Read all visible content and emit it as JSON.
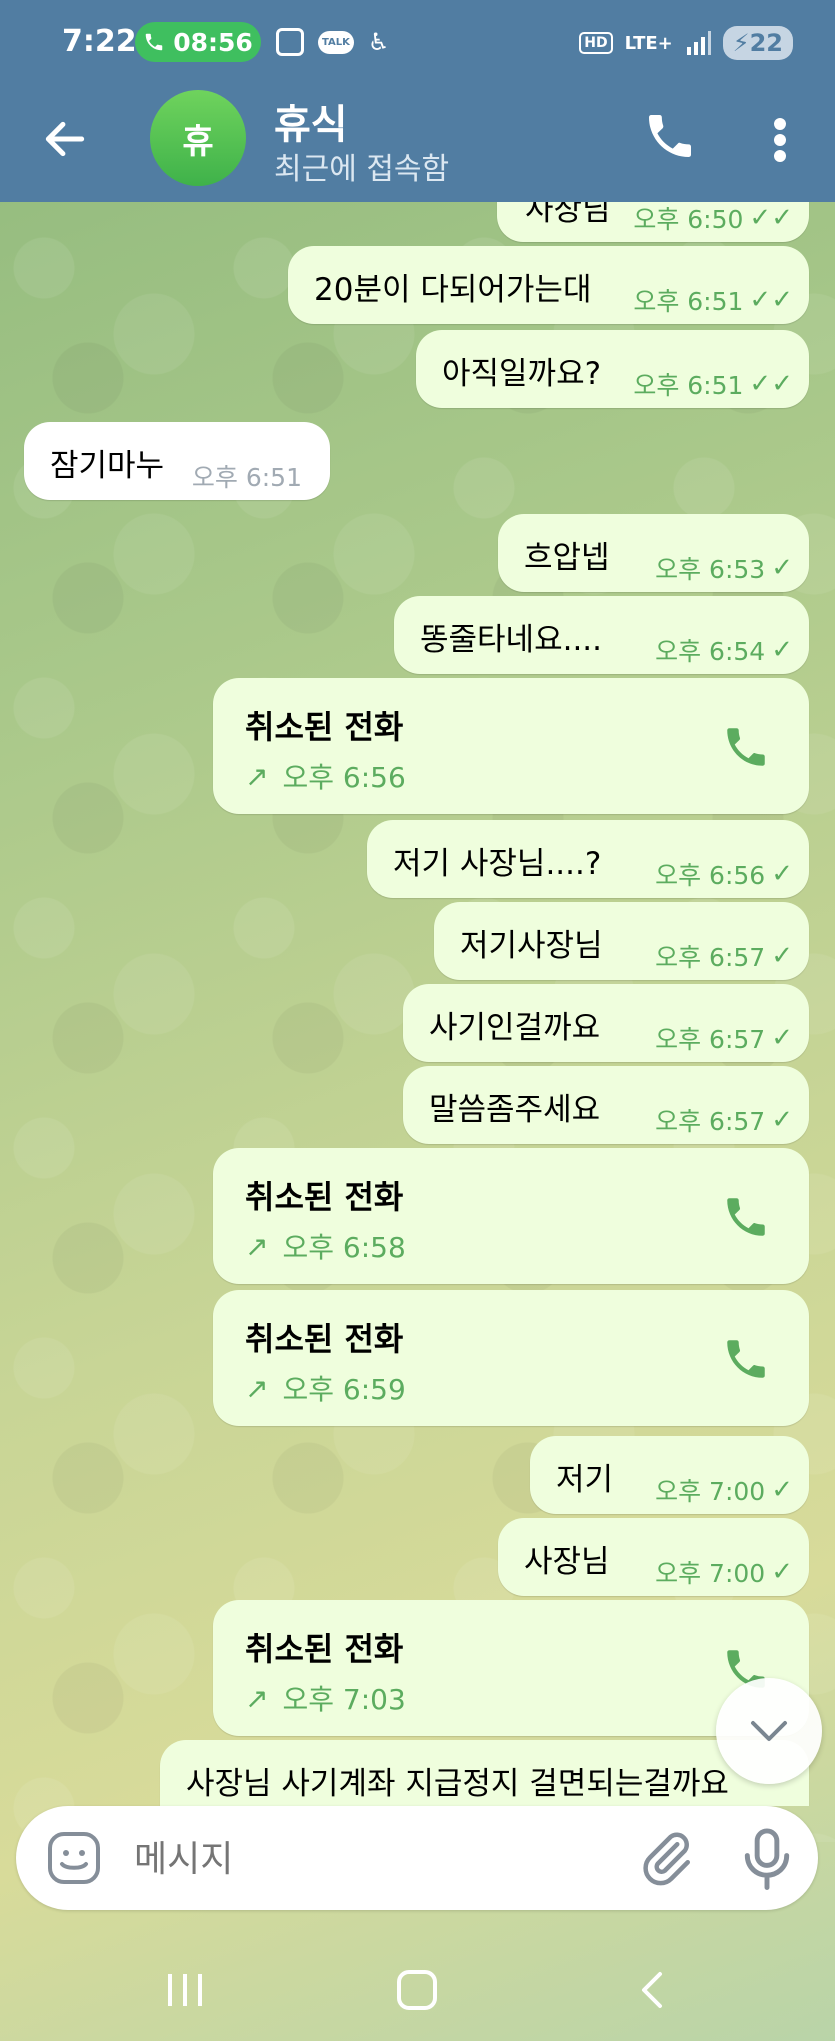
{
  "status_bar": {
    "time": "7:22",
    "call_time": "08:56",
    "talk_label": "TALK",
    "hd": "HD",
    "network": "LTE+",
    "battery": "22"
  },
  "header": {
    "avatar_letter": "휴",
    "contact_name": "휴식",
    "contact_status": "최근에 접속함"
  },
  "messages": [
    {
      "text": "사장님",
      "time": "오후 6:50"
    },
    {
      "text": "20분이 다되어가는대",
      "time": "오후 6:51"
    },
    {
      "text": "아직일까요?",
      "time": "오후 6:51"
    },
    {
      "text": "잠기마누",
      "time": "오후 6:51"
    },
    {
      "text": "흐압넵",
      "time": "오후 6:53"
    },
    {
      "text": "똥줄타네요....",
      "time": "오후 6:54"
    },
    {
      "text": "취소된 전화",
      "time": "오후 6:56"
    },
    {
      "text": "저기 사장님....?",
      "time": "오후 6:56"
    },
    {
      "text": "저기사장님",
      "time": "오후 6:57"
    },
    {
      "text": "사기인걸까요",
      "time": "오후 6:57"
    },
    {
      "text": "말씀좀주세요",
      "time": "오후 6:57"
    },
    {
      "text": "취소된 전화",
      "time": "오후 6:58"
    },
    {
      "text": "취소된 전화",
      "time": "오후 6:59"
    },
    {
      "text": "저기",
      "time": "오후 7:00"
    },
    {
      "text": "사장님",
      "time": "오후 7:00"
    },
    {
      "text": "취소된 전화",
      "time": "오후 7:03"
    },
    {
      "text": "사장님 사기계좌 지급정지 걸면되는걸까요"
    }
  ],
  "input": {
    "placeholder": "메시지"
  },
  "colors": {
    "header": "#517da2",
    "outgoing_bubble": "#effedd",
    "incoming_bubble": "#ffffff",
    "accent_green": "#5cac5f"
  }
}
